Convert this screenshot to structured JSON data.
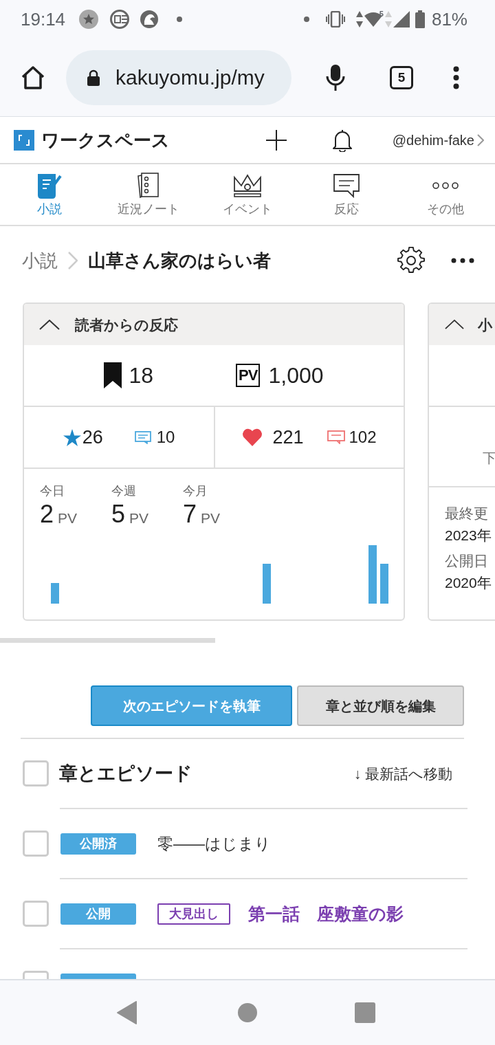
{
  "status_bar": {
    "time": "19:14",
    "wifi_label": "5",
    "battery": "81%"
  },
  "browser": {
    "url": "kakuyomu.jp/my",
    "tab_count": "5"
  },
  "header": {
    "title": "ワークスペース",
    "account": "@dehim-fake"
  },
  "tabs": [
    {
      "label": "小説",
      "kind": "novel",
      "selected": true
    },
    {
      "label": "近況ノート",
      "kind": "notes",
      "selected": false
    },
    {
      "label": "イベント",
      "kind": "event",
      "selected": false
    },
    {
      "label": "反応",
      "kind": "reaction",
      "selected": false
    },
    {
      "label": "その他",
      "kind": "more",
      "selected": false
    }
  ],
  "breadcrumb": {
    "parent": "小説",
    "current": "山草さん家のはらい者"
  },
  "reactions_card": {
    "title": "読者からの反応",
    "expanded": true,
    "follows": "18",
    "pv_icon": "PV",
    "pv_total": "1,000",
    "star_count": "26",
    "reviews": "10",
    "hearts": "221",
    "comments": "102",
    "periods": [
      {
        "label": "今日",
        "value": "2",
        "unit": "PV"
      },
      {
        "label": "今週",
        "value": "5",
        "unit": "PV"
      },
      {
        "label": "今月",
        "value": "7",
        "unit": "PV"
      }
    ]
  },
  "info_card": {
    "title": "小",
    "expanded": true,
    "row_1": "下",
    "fields": [
      {
        "label": "最終更",
        "value": "2023年"
      },
      {
        "label": "公開日",
        "value": "2020年"
      }
    ]
  },
  "actions": [
    {
      "label": "次のエピソードを執筆",
      "kind": "primary"
    },
    {
      "label": "章と並び順を編集",
      "kind": "secondary"
    }
  ],
  "episodes": {
    "header": {
      "label": "章とエピソード",
      "checked": false
    },
    "jump_link": "↓ 最新話へ移動",
    "rows": [
      {
        "kind": "episode",
        "checked": false,
        "status": "公開済",
        "title": "零――はじまり"
      },
      {
        "kind": "chapter",
        "checked": false,
        "status": "公開",
        "tag": "大見出し",
        "title": "第一話　座敷童の影"
      },
      {
        "kind": "episode",
        "checked": false
      }
    ]
  }
}
